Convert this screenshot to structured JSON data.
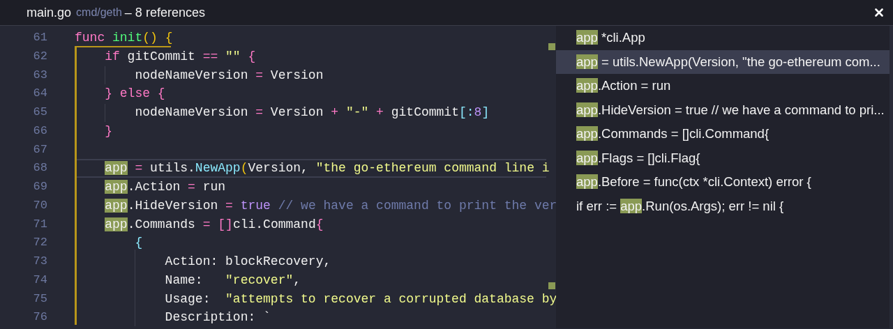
{
  "header": {
    "file": "main.go",
    "path": "cmd/geth",
    "summary": "– 8 references"
  },
  "editor": {
    "lines": [
      {
        "number": "61",
        "current": false,
        "tokens": [
          {
            "text": "func ",
            "kind": "keyword"
          },
          {
            "text": "init",
            "kind": "function"
          },
          {
            "text": "() {",
            "kind": "bracket"
          }
        ]
      },
      {
        "number": "62",
        "current": false,
        "tokens": [
          {
            "text": "    if",
            "kind": "keyword"
          },
          {
            "text": " gitCommit ",
            "kind": "plain"
          },
          {
            "text": "== ",
            "kind": "operator"
          },
          {
            "text": "\"\" ",
            "kind": "string"
          },
          {
            "text": "{",
            "kind": "operator"
          }
        ]
      },
      {
        "number": "63",
        "current": false,
        "tokens": [
          {
            "text": "        nodeNameVersion ",
            "kind": "plain"
          },
          {
            "text": "=",
            "kind": "operator"
          },
          {
            "text": " Version",
            "kind": "plain"
          }
        ]
      },
      {
        "number": "64",
        "current": false,
        "tokens": [
          {
            "text": "    } else {",
            "kind": "keyword"
          }
        ]
      },
      {
        "number": "65",
        "current": false,
        "tokens": [
          {
            "text": "        nodeNameVersion ",
            "kind": "plain"
          },
          {
            "text": "=",
            "kind": "operator"
          },
          {
            "text": " Version ",
            "kind": "plain"
          },
          {
            "text": "+ ",
            "kind": "operator"
          },
          {
            "text": "\"-\" ",
            "kind": "string"
          },
          {
            "text": "+",
            "kind": "operator"
          },
          {
            "text": " gitCommit",
            "kind": "plain"
          },
          {
            "text": "[:",
            "kind": "cyan"
          },
          {
            "text": "8",
            "kind": "number"
          },
          {
            "text": "]",
            "kind": "cyan"
          }
        ]
      },
      {
        "number": "66",
        "current": false,
        "tokens": [
          {
            "text": "    }",
            "kind": "operator"
          }
        ]
      },
      {
        "number": "67",
        "current": false
      },
      {
        "number": "68",
        "current": true,
        "tokens": [
          {
            "text": "    app",
            "kind": "match"
          },
          {
            "text": " =",
            "kind": "operator"
          },
          {
            "text": " utils.",
            "kind": "plain"
          },
          {
            "text": "NewApp",
            "kind": "cyan"
          },
          {
            "text": "(",
            "kind": "bracket"
          },
          {
            "text": "Version, ",
            "kind": "plain"
          },
          {
            "text": "\"the go-ethereum command line i",
            "kind": "string"
          }
        ]
      },
      {
        "number": "69",
        "current": false,
        "tokens": [
          {
            "text": "    app",
            "kind": "match"
          },
          {
            "text": ".Action ",
            "kind": "plain"
          },
          {
            "text": "=",
            "kind": "operator"
          },
          {
            "text": " run",
            "kind": "plain"
          }
        ]
      },
      {
        "number": "70",
        "current": false,
        "tokens": [
          {
            "text": "    app",
            "kind": "match"
          },
          {
            "text": ".HideVersion ",
            "kind": "plain"
          },
          {
            "text": "= ",
            "kind": "operator"
          },
          {
            "text": "true ",
            "kind": "constant"
          },
          {
            "text": "// we have a command to print the ver",
            "kind": "comment"
          }
        ]
      },
      {
        "number": "71",
        "current": false,
        "tokens": [
          {
            "text": "    app",
            "kind": "match"
          },
          {
            "text": ".Commands ",
            "kind": "plain"
          },
          {
            "text": "= []",
            "kind": "operator"
          },
          {
            "text": "cli.Command",
            "kind": "plain"
          },
          {
            "text": "{",
            "kind": "operator"
          }
        ]
      },
      {
        "number": "72",
        "current": false,
        "tokens": [
          {
            "text": "        {",
            "kind": "cyan"
          }
        ]
      },
      {
        "number": "73",
        "current": false,
        "tokens": [
          {
            "text": "            Action: blockRecovery,",
            "kind": "plain"
          }
        ]
      },
      {
        "number": "74",
        "current": false,
        "tokens": [
          {
            "text": "            Name:   ",
            "kind": "plain"
          },
          {
            "text": "\"recover\"",
            "kind": "string"
          },
          {
            "text": ",",
            "kind": "plain"
          }
        ]
      },
      {
        "number": "75",
        "current": false,
        "tokens": [
          {
            "text": "            Usage:  ",
            "kind": "plain"
          },
          {
            "text": "\"attempts to recover a corrupted database by",
            "kind": "string"
          }
        ]
      },
      {
        "number": "76",
        "current": false,
        "tokens": [
          {
            "text": "            Description: `",
            "kind": "plain"
          }
        ]
      }
    ]
  },
  "references": [
    {
      "selected": false,
      "match": "app",
      "after": " *cli.App"
    },
    {
      "selected": true,
      "match": "app",
      "after": " = utils.NewApp(Version, \"the go-ethereum com..."
    },
    {
      "selected": false,
      "match": "app",
      "after": ".Action = run"
    },
    {
      "selected": false,
      "match": "app",
      "after": ".HideVersion = true // we have a command to pri..."
    },
    {
      "selected": false,
      "match": "app",
      "after": ".Commands = []cli.Command{"
    },
    {
      "selected": false,
      "match": "app",
      "after": ".Flags = []cli.Flag{"
    },
    {
      "selected": false,
      "match": "app",
      "after": ".Before = func(ctx *cli.Context) error {"
    },
    {
      "selected": false,
      "before": "if err := ",
      "match": "app",
      "after": ".Run(os.Args); err != nil {"
    }
  ]
}
